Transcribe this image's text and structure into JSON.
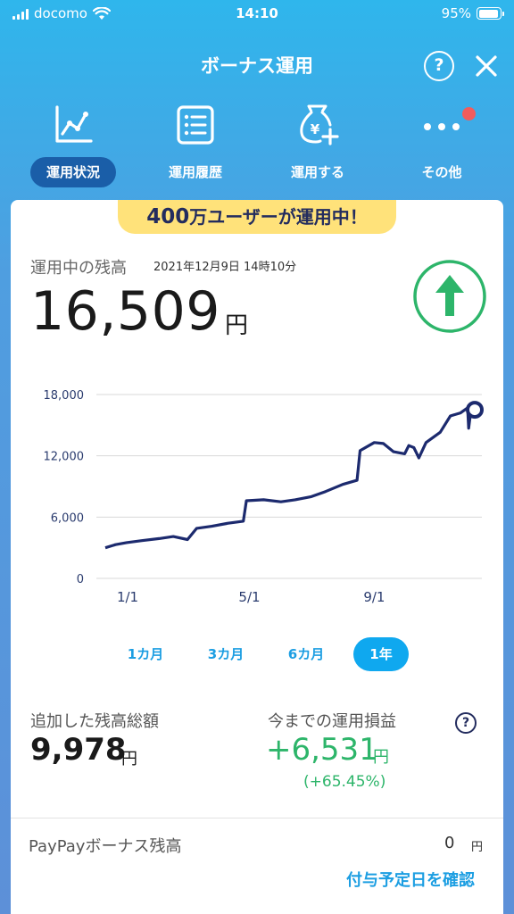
{
  "status_bar": {
    "carrier": "docomo",
    "time": "14:10",
    "battery": "95%",
    "battery_level": 0.95
  },
  "header": {
    "title": "ボーナス運用",
    "help_label": "?"
  },
  "nav": {
    "items": [
      {
        "label": "運用状況",
        "icon": "chart-icon",
        "active": true
      },
      {
        "label": "運用履歴",
        "icon": "list-icon",
        "active": false
      },
      {
        "label": "運用する",
        "icon": "money-bag-plus-icon",
        "active": false
      },
      {
        "label": "その他",
        "icon": "more-icon",
        "active": false,
        "badge": true
      }
    ]
  },
  "promo": {
    "count": "400",
    "text": "万ユーザーが運用中！"
  },
  "balance": {
    "label": "運用中の残高",
    "datetime": "2021年12月9日 14時10分",
    "value": "16,509",
    "unit": "円",
    "trend_icon": "up-arrow-icon"
  },
  "chart_data": {
    "type": "line",
    "y_ticks": [
      "18,000",
      "12,000",
      "6,000",
      "0"
    ],
    "x_ticks": [
      "1/1",
      "5/1",
      "9/1"
    ],
    "ylim": [
      0,
      18000
    ],
    "grid": true,
    "series": [
      {
        "color": "#1c2a6e",
        "points": [
          [
            "2020-12-10",
            3000
          ],
          [
            "2020-12-20",
            3300
          ],
          [
            "2020-12-31",
            3500
          ],
          [
            "2021-01-15",
            3700
          ],
          [
            "2021-02-01",
            3900
          ],
          [
            "2021-02-15",
            4100
          ],
          [
            "2021-03-01",
            3800
          ],
          [
            "2021-03-10",
            4900
          ],
          [
            "2021-03-25",
            5100
          ],
          [
            "2021-04-10",
            5400
          ],
          [
            "2021-04-25",
            5600
          ],
          [
            "2021-04-28",
            7600
          ],
          [
            "2021-05-15",
            7700
          ],
          [
            "2021-06-01",
            7500
          ],
          [
            "2021-06-15",
            7700
          ],
          [
            "2021-07-01",
            8000
          ],
          [
            "2021-07-15",
            8500
          ],
          [
            "2021-08-01",
            9200
          ],
          [
            "2021-08-15",
            9600
          ],
          [
            "2021-08-18",
            12500
          ],
          [
            "2021-09-01",
            13300
          ],
          [
            "2021-09-10",
            13200
          ],
          [
            "2021-09-20",
            12400
          ],
          [
            "2021-10-01",
            12200
          ],
          [
            "2021-10-05",
            13000
          ],
          [
            "2021-10-10",
            12800
          ],
          [
            "2021-10-15",
            11800
          ],
          [
            "2021-10-22",
            13300
          ],
          [
            "2021-11-05",
            14300
          ],
          [
            "2021-11-15",
            15900
          ],
          [
            "2021-11-25",
            16200
          ],
          [
            "2021-12-02",
            16700
          ],
          [
            "2021-12-03",
            14700
          ],
          [
            "2021-12-05",
            16300
          ],
          [
            "2021-12-09",
            16509
          ]
        ]
      }
    ]
  },
  "range": {
    "options": [
      "1カ月",
      "3カ月",
      "6カ月",
      "1年"
    ],
    "selected": "1年"
  },
  "summary": {
    "added_label": "追加した残高総額",
    "added_value": "9,978",
    "added_unit": "円",
    "profit_label": "今までの運用損益",
    "profit_value": "+6,531",
    "profit_unit": "円",
    "profit_pct": "(+65.45%)",
    "help_label": "?"
  },
  "bonus": {
    "label": "PayPayボーナス残高",
    "value": "0",
    "unit": "円",
    "link": "付与予定日を確認"
  },
  "colors": {
    "accent": "#1c9ee2",
    "positive": "#2db56a",
    "navy": "#1c2a6e",
    "badge": "#f25c5c",
    "promo": "#ffe27a"
  }
}
